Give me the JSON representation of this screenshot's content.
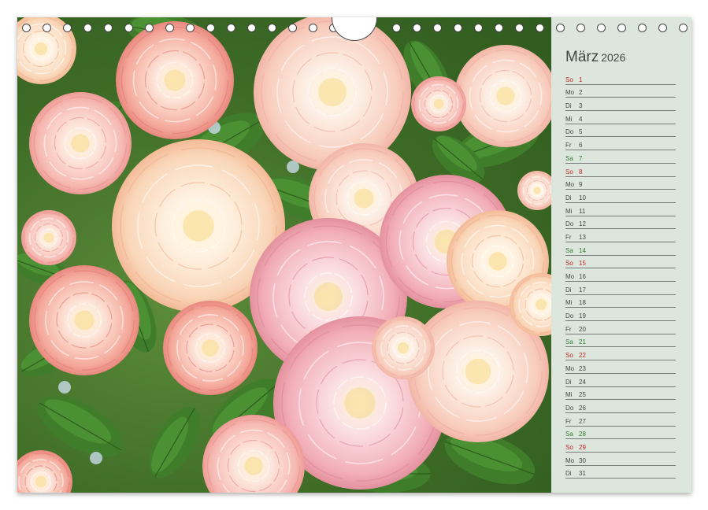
{
  "calendar": {
    "month": "März",
    "year": "2026",
    "days": [
      {
        "wd": "So",
        "d": "1",
        "type": "sun"
      },
      {
        "wd": "Mo",
        "d": "2",
        "type": "week"
      },
      {
        "wd": "Di",
        "d": "3",
        "type": "week"
      },
      {
        "wd": "Mi",
        "d": "4",
        "type": "week"
      },
      {
        "wd": "Do",
        "d": "5",
        "type": "week"
      },
      {
        "wd": "Fr",
        "d": "6",
        "type": "week"
      },
      {
        "wd": "Sa",
        "d": "7",
        "type": "sat"
      },
      {
        "wd": "So",
        "d": "8",
        "type": "sun"
      },
      {
        "wd": "Mo",
        "d": "9",
        "type": "week"
      },
      {
        "wd": "Di",
        "d": "10",
        "type": "week"
      },
      {
        "wd": "Mi",
        "d": "11",
        "type": "week"
      },
      {
        "wd": "Do",
        "d": "12",
        "type": "week"
      },
      {
        "wd": "Fr",
        "d": "13",
        "type": "week"
      },
      {
        "wd": "Sa",
        "d": "14",
        "type": "sat"
      },
      {
        "wd": "So",
        "d": "15",
        "type": "sun"
      },
      {
        "wd": "Mo",
        "d": "16",
        "type": "week"
      },
      {
        "wd": "Di",
        "d": "17",
        "type": "week"
      },
      {
        "wd": "Mi",
        "d": "18",
        "type": "week"
      },
      {
        "wd": "Do",
        "d": "19",
        "type": "week"
      },
      {
        "wd": "Fr",
        "d": "20",
        "type": "week"
      },
      {
        "wd": "Sa",
        "d": "21",
        "type": "sat"
      },
      {
        "wd": "So",
        "d": "22",
        "type": "sun"
      },
      {
        "wd": "Mo",
        "d": "23",
        "type": "week"
      },
      {
        "wd": "Di",
        "d": "24",
        "type": "week"
      },
      {
        "wd": "Mi",
        "d": "25",
        "type": "week"
      },
      {
        "wd": "Do",
        "d": "26",
        "type": "week"
      },
      {
        "wd": "Fr",
        "d": "27",
        "type": "week"
      },
      {
        "wd": "Sa",
        "d": "28",
        "type": "sat"
      },
      {
        "wd": "So",
        "d": "29",
        "type": "sun"
      },
      {
        "wd": "Mo",
        "d": "30",
        "type": "week"
      },
      {
        "wd": "Di",
        "d": "31",
        "type": "week"
      }
    ]
  },
  "photo": {
    "subject": "pink-peach-roses",
    "leaf_color": "#3d7a2a",
    "rose_colors": [
      "#f6c6c4",
      "#f8d7c8",
      "#f3a9a8",
      "#fbe3d4"
    ]
  },
  "colors": {
    "saturday": "#2e7d32",
    "sunday": "#c62828",
    "panel": "#dde6dc"
  }
}
